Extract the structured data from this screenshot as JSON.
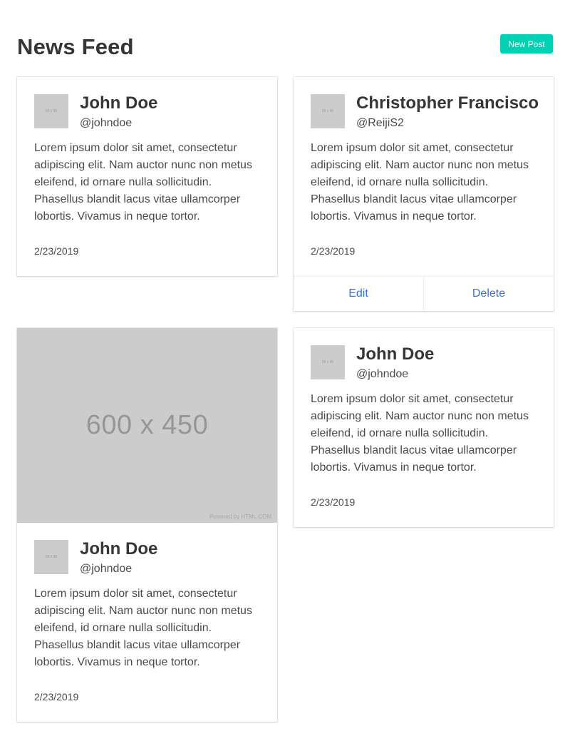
{
  "header": {
    "title": "News Feed",
    "new_post_label": "New Post"
  },
  "colors": {
    "primary": "#00d1b2",
    "link": "#3273dc",
    "placeholder": "#cccccc"
  },
  "posts": [
    {
      "avatar_text": "96 x 96",
      "name": "John Doe",
      "handle": "@johndoe",
      "body": "Lorem ipsum dolor sit amet, consectetur adipiscing elit. Nam auctor nunc non metus eleifend, id ornare nulla sollicitudin. Phasellus blandit lacus vitae ullamcorper lobortis. Vivamus in neque tortor.",
      "date": "2/23/2019"
    },
    {
      "avatar_text": "96 x 96",
      "name": "Christopher Francisco",
      "handle": "@ReijiS2",
      "body": "Lorem ipsum dolor sit amet, consectetur adipiscing elit. Nam auctor nunc non metus eleifend, id ornare nulla sollicitudin. Phasellus blandit lacus vitae ullamcorper lobortis. Vivamus in neque tortor.",
      "date": "2/23/2019",
      "actions": {
        "edit": "Edit",
        "delete": "Delete"
      }
    },
    {
      "image": {
        "text": "600 x 450",
        "credit": "Powered by HTML.COM"
      },
      "avatar_text": "96 x 96",
      "name": "John Doe",
      "handle": "@johndoe",
      "body": "Lorem ipsum dolor sit amet, consectetur adipiscing elit. Nam auctor nunc non metus eleifend, id ornare nulla sollicitudin. Phasellus blandit lacus vitae ullamcorper lobortis. Vivamus in neque tortor.",
      "date": "2/23/2019"
    },
    {
      "avatar_text": "96 x 96",
      "name": "John Doe",
      "handle": "@johndoe",
      "body": "Lorem ipsum dolor sit amet, consectetur adipiscing elit. Nam auctor nunc non metus eleifend, id ornare nulla sollicitudin. Phasellus blandit lacus vitae ullamcorper lobortis. Vivamus in neque tortor.",
      "date": "2/23/2019"
    }
  ]
}
